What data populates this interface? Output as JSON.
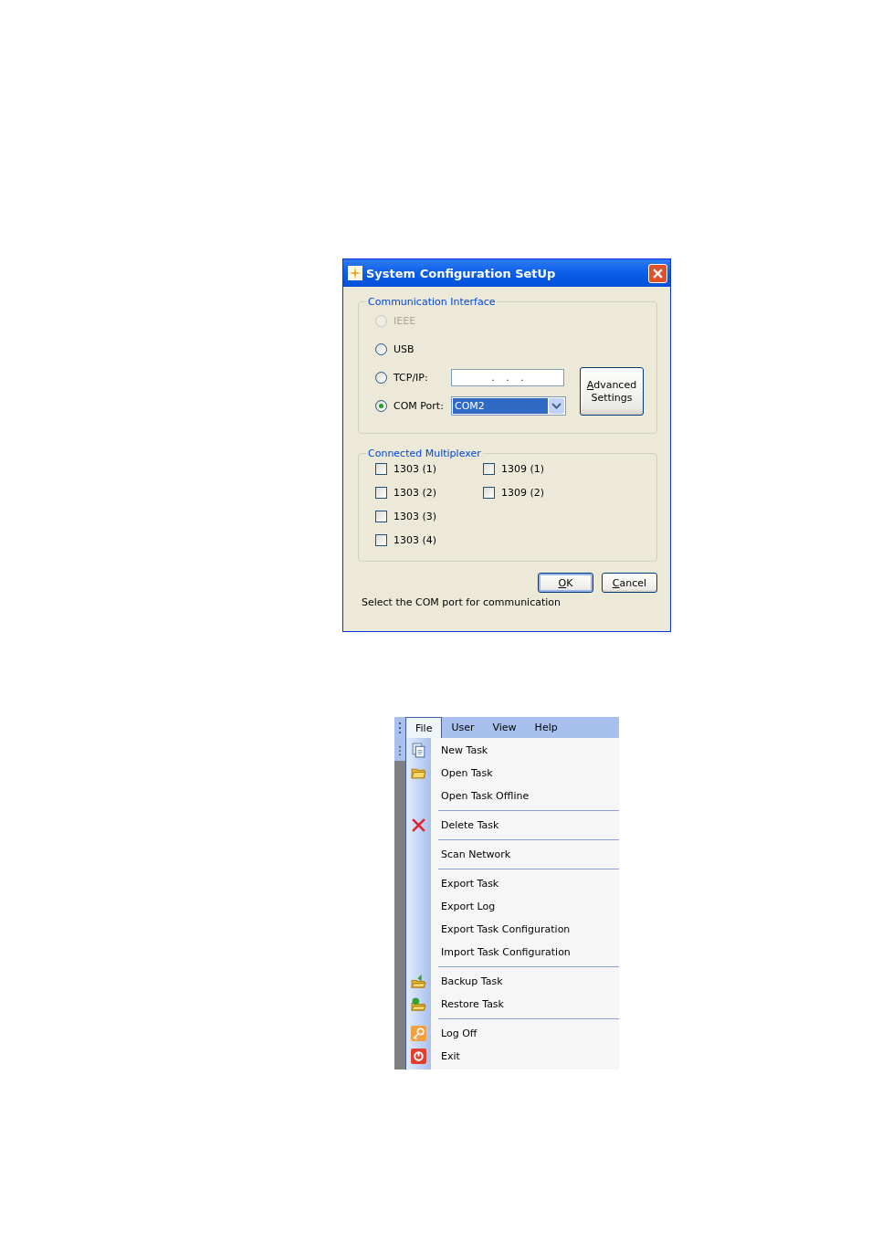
{
  "dialog": {
    "title": "System Configuration SetUp",
    "interface": {
      "legend": "Communication Interface",
      "options": [
        {
          "kind": "plain",
          "label": "IEEE",
          "selected": false,
          "disabled": true
        },
        {
          "kind": "plain",
          "label": "USB",
          "selected": false,
          "disabled": false
        },
        {
          "kind": "ip",
          "label": "TCP/IP:",
          "selected": false,
          "disabled": false,
          "value": ".    .    ."
        },
        {
          "kind": "combo",
          "label": "COM Port:",
          "selected": true,
          "disabled": false,
          "value": "COM2"
        }
      ],
      "advanced_button": {
        "lines": [
          "Advanced",
          "Settings"
        ]
      }
    },
    "multiplexer": {
      "legend": "Connected Multiplexer",
      "columns": [
        [
          {
            "label": "1303 (1)",
            "checked": false
          },
          {
            "label": "1303 (2)",
            "checked": false
          },
          {
            "label": "1303 (3)",
            "checked": false
          },
          {
            "label": "1303 (4)",
            "checked": false
          }
        ],
        [
          {
            "label": "1309 (1)",
            "checked": false
          },
          {
            "label": "1309 (2)",
            "checked": false
          }
        ]
      ]
    },
    "buttons": [
      {
        "label": "OK",
        "default": true
      },
      {
        "label": "Cancel",
        "default": false
      }
    ],
    "status": "Select the COM port for communication"
  },
  "menu": {
    "bar": [
      {
        "label": "File",
        "selected": true
      },
      {
        "label": "User",
        "selected": false
      },
      {
        "label": "View",
        "selected": false
      },
      {
        "label": "Help",
        "selected": false
      }
    ],
    "groups": [
      [
        {
          "label": "New Task",
          "kind": "document"
        },
        {
          "label": "Open Task",
          "kind": "folder"
        },
        {
          "label": "Open Task Offline",
          "kind": "plain"
        }
      ],
      [
        {
          "label": "Delete Task",
          "kind": "delete"
        }
      ],
      [
        {
          "label": "Scan Network",
          "kind": "plain"
        }
      ],
      [
        {
          "label": "Export Task",
          "kind": "plain"
        },
        {
          "label": "Export Log",
          "kind": "plain"
        },
        {
          "label": "Export Task Configuration",
          "kind": "plain"
        },
        {
          "label": "Import Task Configuration",
          "kind": "plain"
        }
      ],
      [
        {
          "label": "Backup Task",
          "kind": "backup"
        },
        {
          "label": "Restore Task",
          "kind": "restore"
        }
      ],
      [
        {
          "label": "Log Off",
          "kind": "logoff"
        },
        {
          "label": "Exit",
          "kind": "exit"
        }
      ]
    ]
  }
}
